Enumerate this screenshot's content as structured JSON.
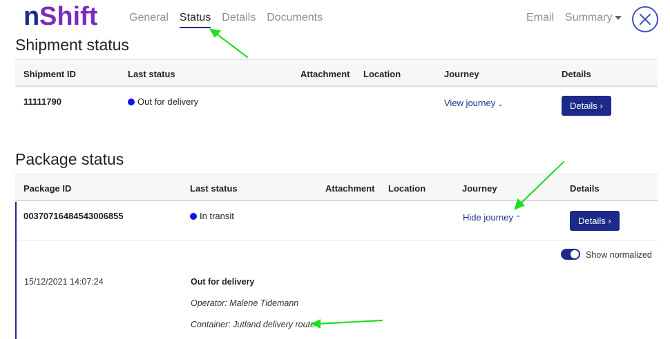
{
  "brand": {
    "logo_text": "nShift",
    "accent": "#1d2a8a",
    "logo_color": "#7b2cbf"
  },
  "nav": {
    "tabs": [
      {
        "label": "General"
      },
      {
        "label": "Status",
        "active": true
      },
      {
        "label": "Details"
      },
      {
        "label": "Documents"
      }
    ],
    "email_label": "Email",
    "summary_label": "Summary",
    "close_icon": "close-icon"
  },
  "shipment": {
    "heading": "Shipment status",
    "columns": [
      "Shipment ID",
      "Last status",
      "Attachment",
      "Location",
      "Journey",
      "Details"
    ],
    "row": {
      "id": "11111790",
      "status": "Out for delivery",
      "status_color": "#1212e6",
      "journey_link": "View journey",
      "details_button": "Details"
    }
  },
  "package": {
    "heading": "Package status",
    "columns": [
      "Package ID",
      "Last status",
      "Attachment",
      "Location",
      "Journey",
      "Details"
    ],
    "row": {
      "id": "00370716484543006855",
      "status": "In transit",
      "status_color": "#1212e6",
      "journey_link": "Hide journey",
      "details_button": "Details"
    },
    "journey": {
      "toggle_label": "Show normalized",
      "toggle_on": true,
      "event": {
        "timestamp": "15/12/2021 14:07:24",
        "title": "Out for delivery",
        "operator": "Operator: Malene Tidemann",
        "container": "Container: Jutland delivery route"
      }
    }
  },
  "annotation_color": "#22dd22"
}
